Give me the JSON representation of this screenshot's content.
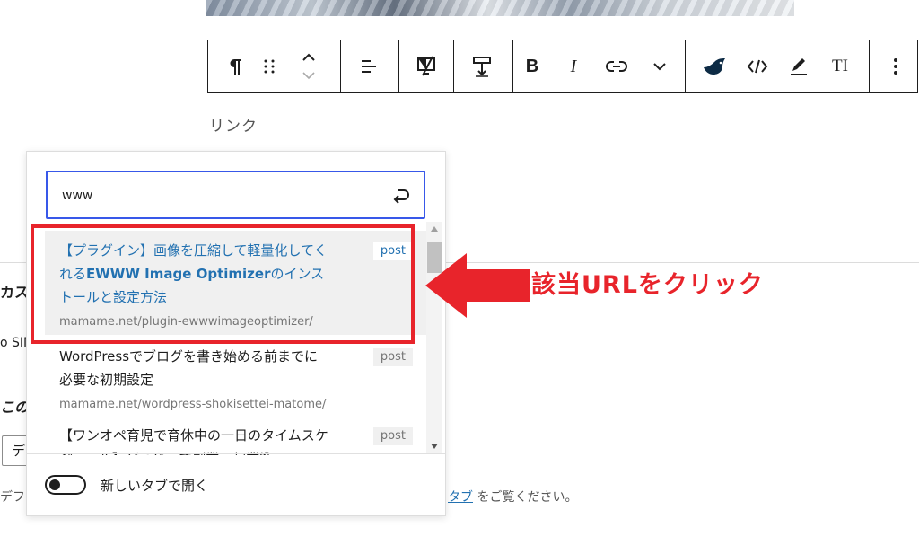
{
  "toolbar": {
    "buttons": [
      "paragraph",
      "drag",
      "move-up-down",
      "align",
      "hide-on-device",
      "spacing",
      "bold",
      "italic",
      "link",
      "more-rich-text",
      "brand-swallow",
      "code",
      "highlight",
      "text-size",
      "options"
    ],
    "bold_label": "B",
    "italic_label": "I",
    "text_size_label": "TI"
  },
  "editor": {
    "link_label": "リンク",
    "bg_heading_fragment": "カス",
    "bg_sin_fragment": "o SIN",
    "bg_kono_fragment": "この",
    "bg_select_value": "デ",
    "bg_help_start": "デフ",
    "bg_help_link": "タブ",
    "bg_help_end": "をご覧ください。"
  },
  "link_popover": {
    "input_value": "www",
    "results": [
      {
        "title_pre": "【プラグイン】画像を圧縮して軽量化してくれる",
        "title_highlight": "EWWW Image Optimizer",
        "title_post": "のインストールと設定方法",
        "url": "mamame.net/plugin-ewwwimageoptimizer/",
        "type": "post",
        "selected": true
      },
      {
        "title_pre": "WordPressでブログを書き始める前までに必要な初期設定",
        "title_highlight": "",
        "title_post": "",
        "url": "mamame.net/wordpress-shokisettei-matome/",
        "type": "post",
        "selected": false
      },
      {
        "title_pre": "【ワンオペ育児で育休中の一日のタイムスケジュール】どうやって副業・起業準",
        "title_highlight": "",
        "title_post": "",
        "url": "",
        "type": "post",
        "selected": false
      }
    ],
    "new_tab_label": "新しいタブで開く",
    "new_tab_enabled": false
  },
  "annotation": {
    "text": "該当URLをクリック",
    "color": "#e8242b"
  },
  "colors": {
    "accent": "#3858e9",
    "link": "#2271b1",
    "annotation": "#e8242b"
  }
}
